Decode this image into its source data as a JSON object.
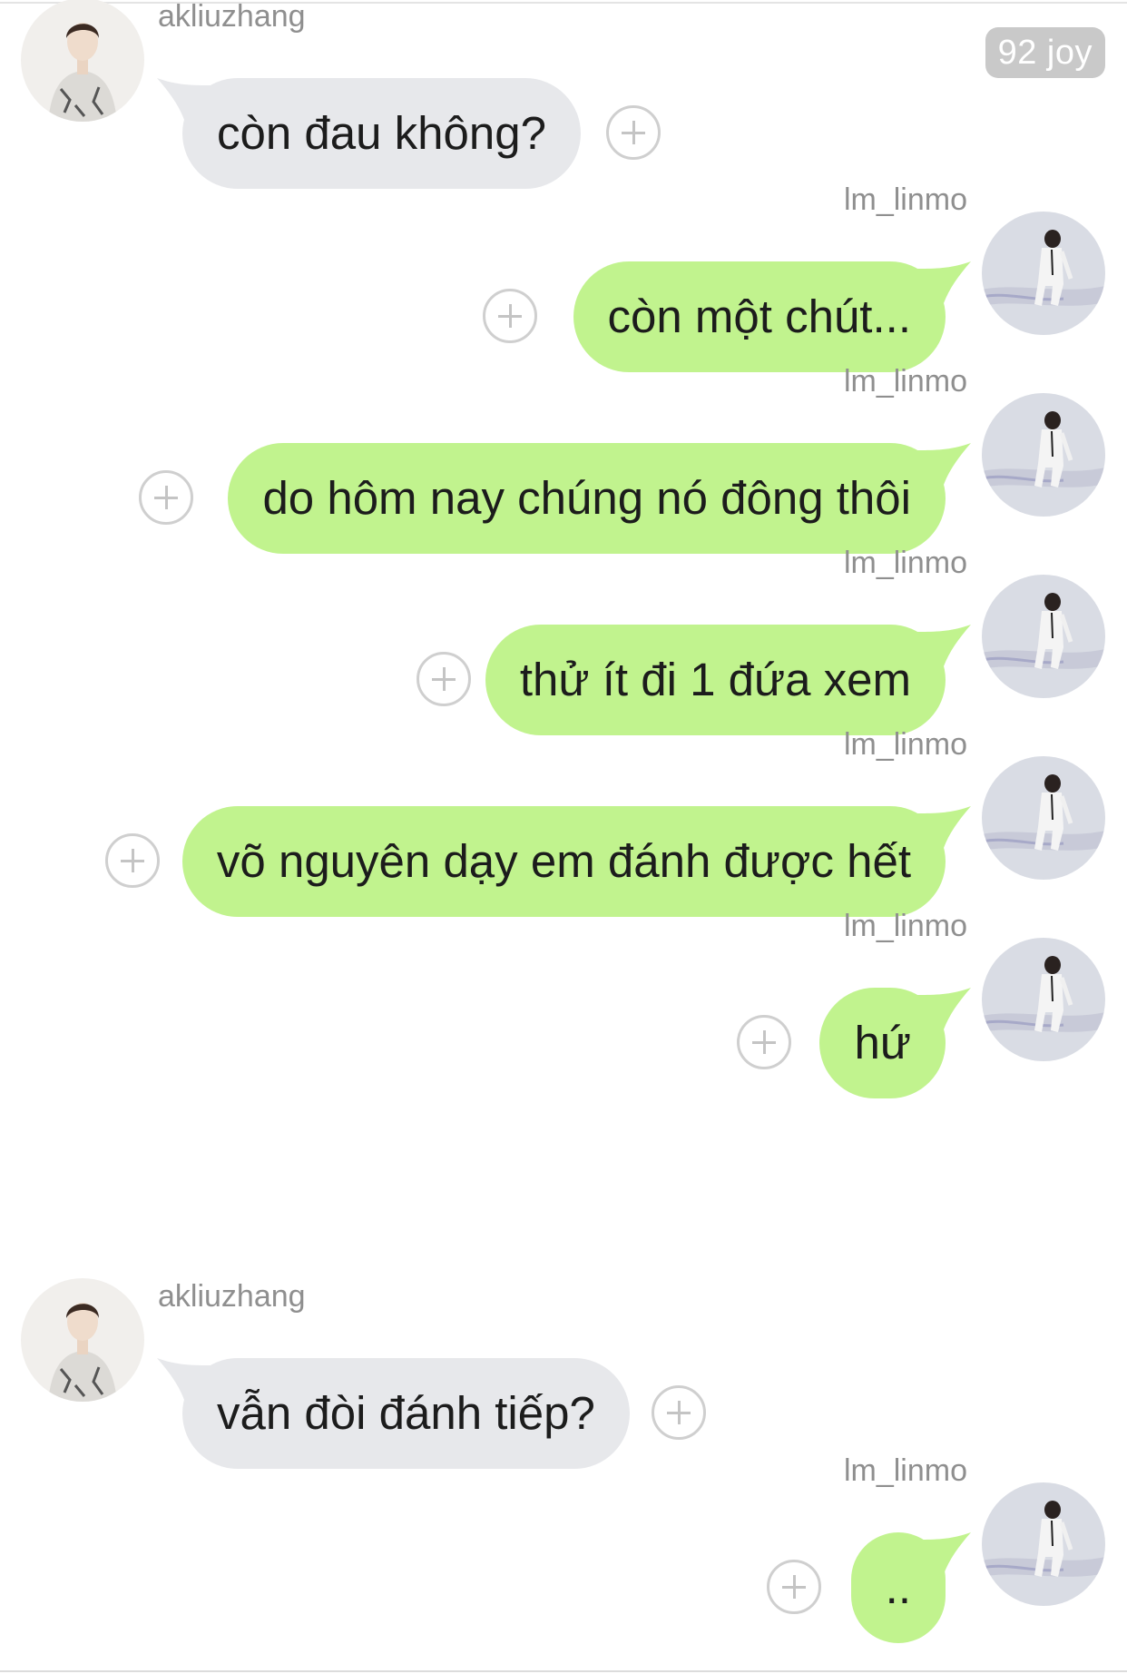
{
  "badge": "92 joy",
  "messages": [
    {
      "side": "left",
      "sender": "akliuzhang",
      "text": "còn đau không?"
    },
    {
      "side": "right",
      "sender": "lm_linmo",
      "text": "còn một chút..."
    },
    {
      "side": "right",
      "sender": "lm_linmo",
      "text": "do hôm nay chúng nó đông thôi"
    },
    {
      "side": "right",
      "sender": "lm_linmo",
      "text": "thử ít đi 1 đứa xem"
    },
    {
      "side": "right",
      "sender": "lm_linmo",
      "text": "võ nguyên dạy em đánh được hết"
    },
    {
      "side": "right",
      "sender": "lm_linmo",
      "text": "hứ"
    },
    {
      "side": "left",
      "sender": "akliuzhang",
      "text": "vẫn đòi đánh tiếp?"
    },
    {
      "side": "right",
      "sender": "lm_linmo",
      "text": ".."
    }
  ],
  "colors": {
    "incoming_bubble": "#e7e8eb",
    "outgoing_bubble": "#c1f38e",
    "badge": "#c9c9c9",
    "sender_name": "#8f8f8f"
  },
  "icons": {
    "add_reaction": "plus-circle-icon"
  }
}
